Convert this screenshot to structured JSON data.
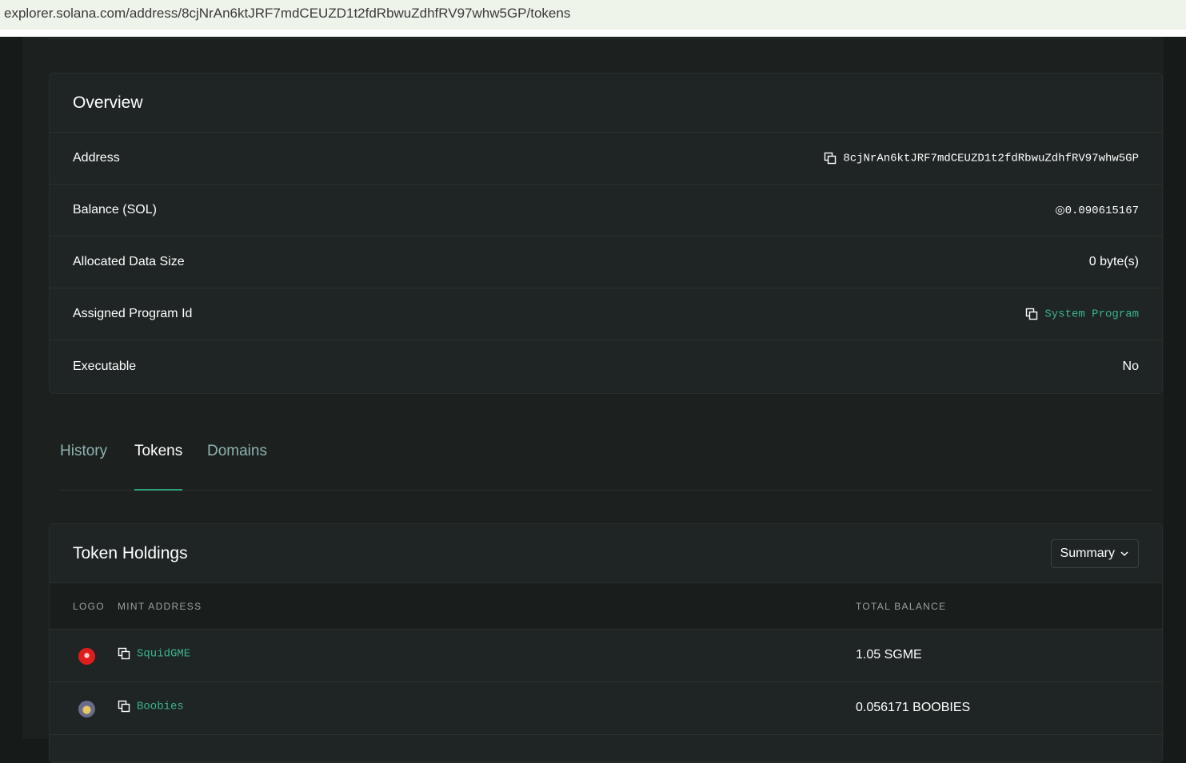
{
  "browser": {
    "url": "explorer.solana.com/address/8cjNrAn6ktJRF7mdCEUZD1t2fdRbwuZdhfRV97whw5GP/tokens"
  },
  "overview": {
    "title": "Overview",
    "rows": [
      {
        "label": "Address",
        "value": "8cjNrAn6ktJRF7mdCEUZD1t2fdRbwuZdhfRV97whw5GP"
      },
      {
        "label": "Balance (SOL)",
        "value": "◎0.090615167"
      },
      {
        "label": "Allocated Data Size",
        "value": "0 byte(s)"
      },
      {
        "label": "Assigned Program Id",
        "value": "System Program"
      },
      {
        "label": "Executable",
        "value": "No"
      }
    ]
  },
  "tabs": [
    {
      "label": "History",
      "active": false
    },
    {
      "label": "Tokens",
      "active": true
    },
    {
      "label": "Domains",
      "active": false
    }
  ],
  "holdings": {
    "title": "Token Holdings",
    "view_select": "Summary",
    "columns": {
      "logo": "LOGO",
      "mint": "MINT ADDRESS",
      "balance": "TOTAL BALANCE"
    },
    "rows": [
      {
        "mint": "SquidGME",
        "balance": "1.05 SGME",
        "logo_color": "#e01d1d"
      },
      {
        "mint": "Boobies",
        "balance": "0.056171 BOOBIES",
        "logo_color": "#c9b24a"
      }
    ]
  },
  "colors": {
    "accent": "#3bb38f",
    "tab_underline": "#2fa17c",
    "background": "#1c2120"
  }
}
